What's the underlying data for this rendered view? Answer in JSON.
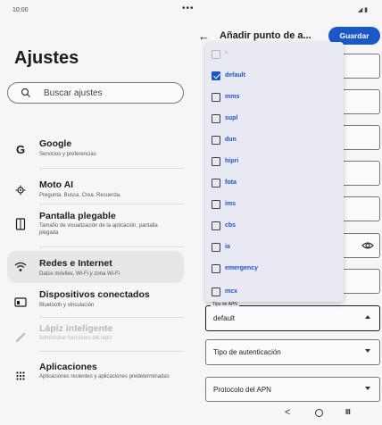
{
  "status_bar": {
    "time": "10:00",
    "dots": "•••",
    "icons": "◢ ▮"
  },
  "settings": {
    "title": "Ajustes",
    "search_placeholder": "Buscar ajustes",
    "items": [
      {
        "title": "Google",
        "subtitle": "Servicios y preferencias",
        "icon": "google-icon"
      },
      {
        "title": "Moto AI",
        "subtitle": "Pregunta. Busca. Crea. Recuerda.",
        "icon": "moto-ai-icon"
      },
      {
        "title": "Pantalla plegable",
        "subtitle": "Tamaño de visualización de la aplicación, pantalla plegada",
        "icon": "foldable-icon"
      },
      {
        "title": "Redes e Internet",
        "subtitle": "Datos móviles, Wi-Fi y zona Wi-Fi",
        "icon": "wifi-icon"
      },
      {
        "title": "Dispositivos conectados",
        "subtitle": "Bluetooth y vinculación",
        "icon": "devices-icon"
      },
      {
        "title": "Lápiz inteligente",
        "subtitle": "Administrar funciones del lápiz",
        "icon": "pen-icon"
      },
      {
        "title": "Aplicaciones",
        "subtitle": "Aplicaciones recientes y aplicaciones predeterminadas",
        "icon": "apps-icon"
      }
    ]
  },
  "apn": {
    "header_title": "Añadir punto de a...",
    "save_label": "Guardar",
    "apn_type_label": "Tipo de APN",
    "apn_type_value": "default",
    "auth_type_label": "Tipo de autenticación",
    "protocol_label": "Protocolo del APN"
  },
  "dropdown": {
    "options": [
      {
        "label": "*",
        "checked": false,
        "faded": true
      },
      {
        "label": "default",
        "checked": true,
        "faded": false
      },
      {
        "label": "mms",
        "checked": false,
        "faded": false
      },
      {
        "label": "supl",
        "checked": false,
        "faded": false
      },
      {
        "label": "dun",
        "checked": false,
        "faded": false
      },
      {
        "label": "hipri",
        "checked": false,
        "faded": false
      },
      {
        "label": "fota",
        "checked": false,
        "faded": false
      },
      {
        "label": "ims",
        "checked": false,
        "faded": false
      },
      {
        "label": "cbs",
        "checked": false,
        "faded": false
      },
      {
        "label": "ia",
        "checked": false,
        "faded": false
      },
      {
        "label": "emergency",
        "checked": false,
        "faded": false
      },
      {
        "label": "mcx",
        "checked": false,
        "faded": false
      }
    ]
  },
  "nav": {
    "back": "<",
    "recent": "III"
  },
  "colors": {
    "accent": "#1a57c7",
    "background": "#f6f6f8",
    "selected_bg": "#e7e7ea",
    "dropdown_bg": "#e9e9f3"
  }
}
